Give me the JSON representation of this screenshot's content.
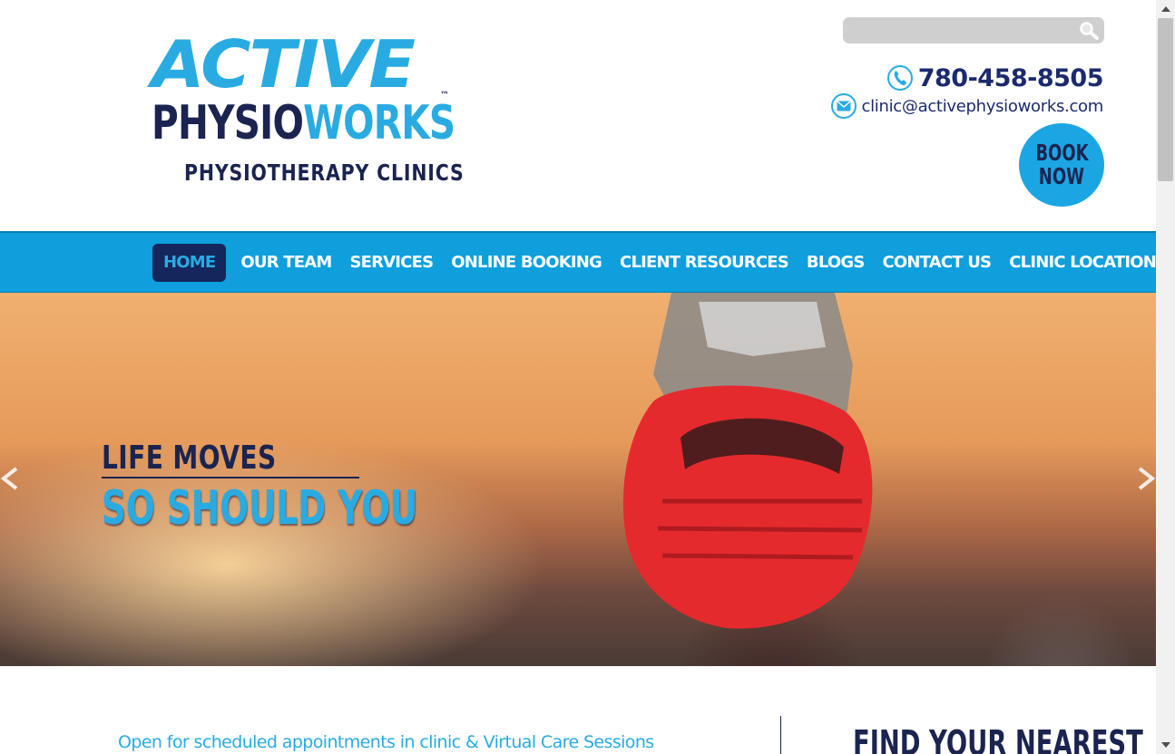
{
  "logo": {
    "line1": "ACTIVE",
    "line2a": "PHYSIO",
    "line2b": "WORKS",
    "tm": "™",
    "line3": "PHYSIOTHERAPY CLINICS"
  },
  "header": {
    "search_placeholder": "",
    "phone": "780-458-8505",
    "email": "clinic@activephysioworks.com",
    "book_line1": "BOOK",
    "book_line2": "NOW"
  },
  "nav": {
    "items": [
      {
        "label": "HOME",
        "active": true
      },
      {
        "label": "OUR TEAM"
      },
      {
        "label": "SERVICES"
      },
      {
        "label": "ONLINE BOOKING"
      },
      {
        "label": "CLIENT RESOURCES"
      },
      {
        "label": "BLOGS"
      },
      {
        "label": "CONTACT US"
      },
      {
        "label": "CLINIC LOCATIONS"
      }
    ]
  },
  "hero": {
    "title1": "LIFE MOVES",
    "title2": "SO SHOULD YOU"
  },
  "content": {
    "notice": "Open for scheduled appointments in clinic & Virtual Care Sessions",
    "find_heading": "FIND YOUR NEAREST"
  },
  "colors": {
    "brand_blue": "#29abe2",
    "brand_navy": "#1b2450",
    "nav_bg": "#0e9fdc"
  }
}
